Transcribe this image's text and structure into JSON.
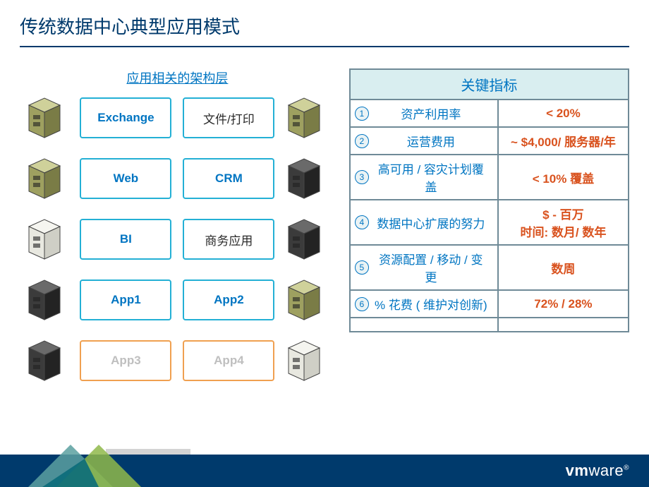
{
  "title": "传统数据中心典型应用模式",
  "left": {
    "heading": "应用相关的架构层",
    "rows": [
      {
        "a": "Exchange",
        "b": "文件/打印",
        "a_style": "blue",
        "b_style": "black",
        "svr_a": "olive",
        "svr_b": "olive"
      },
      {
        "a": "Web",
        "b": "CRM",
        "a_style": "blue",
        "b_style": "blue",
        "svr_a": "olive",
        "svr_b": "dark"
      },
      {
        "a": "BI",
        "b": "商务应用",
        "a_style": "blue",
        "b_style": "black",
        "svr_a": "white",
        "svr_b": "dark"
      },
      {
        "a": "App1",
        "b": "App2",
        "a_style": "blue",
        "b_style": "blue",
        "svr_a": "dark",
        "svr_b": "olive"
      },
      {
        "a": "App3",
        "b": "App4",
        "a_style": "grey",
        "b_style": "grey",
        "svr_a": "dark",
        "svr_b": "white"
      }
    ]
  },
  "right": {
    "heading": "关键指标",
    "rows": [
      {
        "n": "1",
        "label": "资产利用率",
        "value": "< 20%"
      },
      {
        "n": "2",
        "label": "运营费用",
        "value": "~ $4,000/ 服务器/年"
      },
      {
        "n": "3",
        "label": "高可用 / 容灾计划覆盖",
        "value": "< 10% 覆盖"
      },
      {
        "n": "4",
        "label": "数据中心扩展的努力",
        "value": "$ - 百万\n时间: 数月/ 数年"
      },
      {
        "n": "5",
        "label": "资源配置 / 移动 / 变更",
        "value": "数周"
      },
      {
        "n": "6",
        "label": "% 花费 ( 维护对创新)",
        "value": "72% / 28%"
      }
    ]
  },
  "footer": {
    "logo_bold": "vm",
    "logo_rest": "ware"
  }
}
